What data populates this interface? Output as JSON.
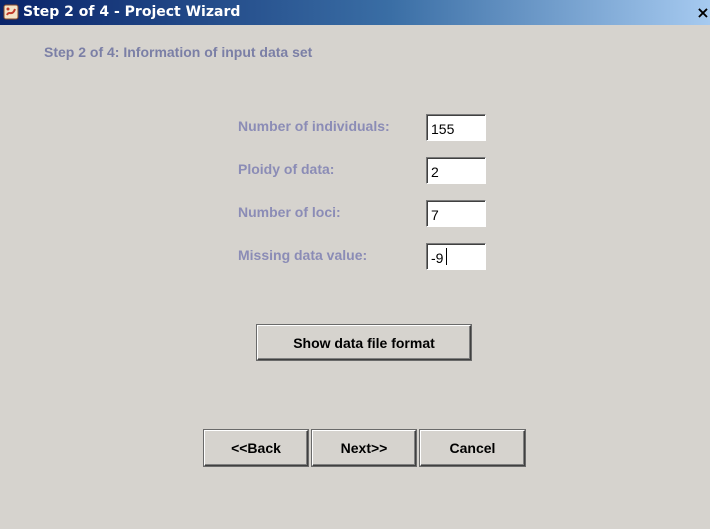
{
  "window": {
    "title": "Step 2 of 4 - Project Wizard",
    "close_glyph": "×",
    "icon": "java-app-icon"
  },
  "step_header": "Step 2 of 4: Information of input data set",
  "fields": [
    {
      "label": "Number of individuals:",
      "value": "155"
    },
    {
      "label": "Ploidy of data:",
      "value": "2"
    },
    {
      "label": "Number of loci:",
      "value": "7"
    },
    {
      "label": "Missing data value:",
      "value": "-9"
    }
  ],
  "buttons": {
    "show_format": "Show data file format",
    "back": "<<Back",
    "next": "Next>>",
    "cancel": "Cancel"
  },
  "colors": {
    "label_color": "#8b8cb6",
    "header_color": "#7b7fa6",
    "background": "#d6d3ce"
  }
}
